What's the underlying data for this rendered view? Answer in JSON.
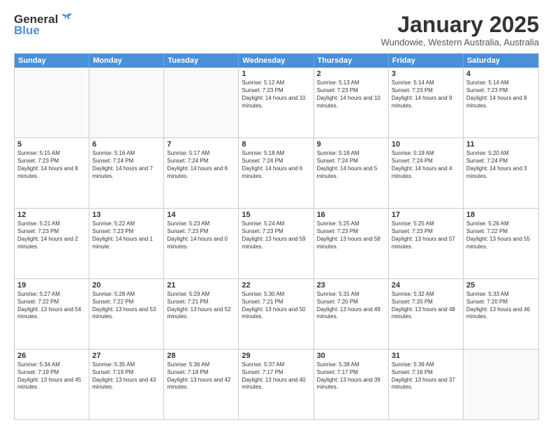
{
  "header": {
    "logo_general": "General",
    "logo_blue": "Blue",
    "title": "January 2025",
    "location": "Wundowie, Western Australia, Australia"
  },
  "days": [
    "Sunday",
    "Monday",
    "Tuesday",
    "Wednesday",
    "Thursday",
    "Friday",
    "Saturday"
  ],
  "weeks": [
    [
      {
        "day": "",
        "sunrise": "",
        "sunset": "",
        "daylight": "",
        "empty": true
      },
      {
        "day": "",
        "sunrise": "",
        "sunset": "",
        "daylight": "",
        "empty": true
      },
      {
        "day": "",
        "sunrise": "",
        "sunset": "",
        "daylight": "",
        "empty": true
      },
      {
        "day": "1",
        "sunrise": "Sunrise: 5:12 AM",
        "sunset": "Sunset: 7:23 PM",
        "daylight": "Daylight: 14 hours and 10 minutes.",
        "empty": false
      },
      {
        "day": "2",
        "sunrise": "Sunrise: 5:13 AM",
        "sunset": "Sunset: 7:23 PM",
        "daylight": "Daylight: 14 hours and 10 minutes.",
        "empty": false
      },
      {
        "day": "3",
        "sunrise": "Sunrise: 5:14 AM",
        "sunset": "Sunset: 7:23 PM",
        "daylight": "Daylight: 14 hours and 9 minutes.",
        "empty": false
      },
      {
        "day": "4",
        "sunrise": "Sunrise: 5:14 AM",
        "sunset": "Sunset: 7:23 PM",
        "daylight": "Daylight: 14 hours and 8 minutes.",
        "empty": false
      }
    ],
    [
      {
        "day": "5",
        "sunrise": "Sunrise: 5:15 AM",
        "sunset": "Sunset: 7:23 PM",
        "daylight": "Daylight: 14 hours and 8 minutes.",
        "empty": false
      },
      {
        "day": "6",
        "sunrise": "Sunrise: 5:16 AM",
        "sunset": "Sunset: 7:24 PM",
        "daylight": "Daylight: 14 hours and 7 minutes.",
        "empty": false
      },
      {
        "day": "7",
        "sunrise": "Sunrise: 5:17 AM",
        "sunset": "Sunset: 7:24 PM",
        "daylight": "Daylight: 14 hours and 6 minutes.",
        "empty": false
      },
      {
        "day": "8",
        "sunrise": "Sunrise: 5:18 AM",
        "sunset": "Sunset: 7:24 PM",
        "daylight": "Daylight: 14 hours and 6 minutes.",
        "empty": false
      },
      {
        "day": "9",
        "sunrise": "Sunrise: 5:18 AM",
        "sunset": "Sunset: 7:24 PM",
        "daylight": "Daylight: 14 hours and 5 minutes.",
        "empty": false
      },
      {
        "day": "10",
        "sunrise": "Sunrise: 5:19 AM",
        "sunset": "Sunset: 7:24 PM",
        "daylight": "Daylight: 14 hours and 4 minutes.",
        "empty": false
      },
      {
        "day": "11",
        "sunrise": "Sunrise: 5:20 AM",
        "sunset": "Sunset: 7:24 PM",
        "daylight": "Daylight: 14 hours and 3 minutes.",
        "empty": false
      }
    ],
    [
      {
        "day": "12",
        "sunrise": "Sunrise: 5:21 AM",
        "sunset": "Sunset: 7:23 PM",
        "daylight": "Daylight: 14 hours and 2 minutes.",
        "empty": false
      },
      {
        "day": "13",
        "sunrise": "Sunrise: 5:22 AM",
        "sunset": "Sunset: 7:23 PM",
        "daylight": "Daylight: 14 hours and 1 minute.",
        "empty": false
      },
      {
        "day": "14",
        "sunrise": "Sunrise: 5:23 AM",
        "sunset": "Sunset: 7:23 PM",
        "daylight": "Daylight: 14 hours and 0 minutes.",
        "empty": false
      },
      {
        "day": "15",
        "sunrise": "Sunrise: 5:24 AM",
        "sunset": "Sunset: 7:23 PM",
        "daylight": "Daylight: 13 hours and 59 minutes.",
        "empty": false
      },
      {
        "day": "16",
        "sunrise": "Sunrise: 5:25 AM",
        "sunset": "Sunset: 7:23 PM",
        "daylight": "Daylight: 13 hours and 58 minutes.",
        "empty": false
      },
      {
        "day": "17",
        "sunrise": "Sunrise: 5:25 AM",
        "sunset": "Sunset: 7:23 PM",
        "daylight": "Daylight: 13 hours and 57 minutes.",
        "empty": false
      },
      {
        "day": "18",
        "sunrise": "Sunrise: 5:26 AM",
        "sunset": "Sunset: 7:22 PM",
        "daylight": "Daylight: 13 hours and 55 minutes.",
        "empty": false
      }
    ],
    [
      {
        "day": "19",
        "sunrise": "Sunrise: 5:27 AM",
        "sunset": "Sunset: 7:22 PM",
        "daylight": "Daylight: 13 hours and 54 minutes.",
        "empty": false
      },
      {
        "day": "20",
        "sunrise": "Sunrise: 5:28 AM",
        "sunset": "Sunset: 7:22 PM",
        "daylight": "Daylight: 13 hours and 53 minutes.",
        "empty": false
      },
      {
        "day": "21",
        "sunrise": "Sunrise: 5:29 AM",
        "sunset": "Sunset: 7:21 PM",
        "daylight": "Daylight: 13 hours and 52 minutes.",
        "empty": false
      },
      {
        "day": "22",
        "sunrise": "Sunrise: 5:30 AM",
        "sunset": "Sunset: 7:21 PM",
        "daylight": "Daylight: 13 hours and 50 minutes.",
        "empty": false
      },
      {
        "day": "23",
        "sunrise": "Sunrise: 5:31 AM",
        "sunset": "Sunset: 7:20 PM",
        "daylight": "Daylight: 13 hours and 49 minutes.",
        "empty": false
      },
      {
        "day": "24",
        "sunrise": "Sunrise: 5:32 AM",
        "sunset": "Sunset: 7:20 PM",
        "daylight": "Daylight: 13 hours and 48 minutes.",
        "empty": false
      },
      {
        "day": "25",
        "sunrise": "Sunrise: 5:33 AM",
        "sunset": "Sunset: 7:20 PM",
        "daylight": "Daylight: 13 hours and 46 minutes.",
        "empty": false
      }
    ],
    [
      {
        "day": "26",
        "sunrise": "Sunrise: 5:34 AM",
        "sunset": "Sunset: 7:19 PM",
        "daylight": "Daylight: 13 hours and 45 minutes.",
        "empty": false
      },
      {
        "day": "27",
        "sunrise": "Sunrise: 5:35 AM",
        "sunset": "Sunset: 7:19 PM",
        "daylight": "Daylight: 13 hours and 43 minutes.",
        "empty": false
      },
      {
        "day": "28",
        "sunrise": "Sunrise: 5:36 AM",
        "sunset": "Sunset: 7:18 PM",
        "daylight": "Daylight: 13 hours and 42 minutes.",
        "empty": false
      },
      {
        "day": "29",
        "sunrise": "Sunrise: 5:37 AM",
        "sunset": "Sunset: 7:17 PM",
        "daylight": "Daylight: 13 hours and 40 minutes.",
        "empty": false
      },
      {
        "day": "30",
        "sunrise": "Sunrise: 5:38 AM",
        "sunset": "Sunset: 7:17 PM",
        "daylight": "Daylight: 13 hours and 39 minutes.",
        "empty": false
      },
      {
        "day": "31",
        "sunrise": "Sunrise: 5:39 AM",
        "sunset": "Sunset: 7:16 PM",
        "daylight": "Daylight: 13 hours and 37 minutes.",
        "empty": false
      },
      {
        "day": "",
        "sunrise": "",
        "sunset": "",
        "daylight": "",
        "empty": true
      }
    ]
  ]
}
